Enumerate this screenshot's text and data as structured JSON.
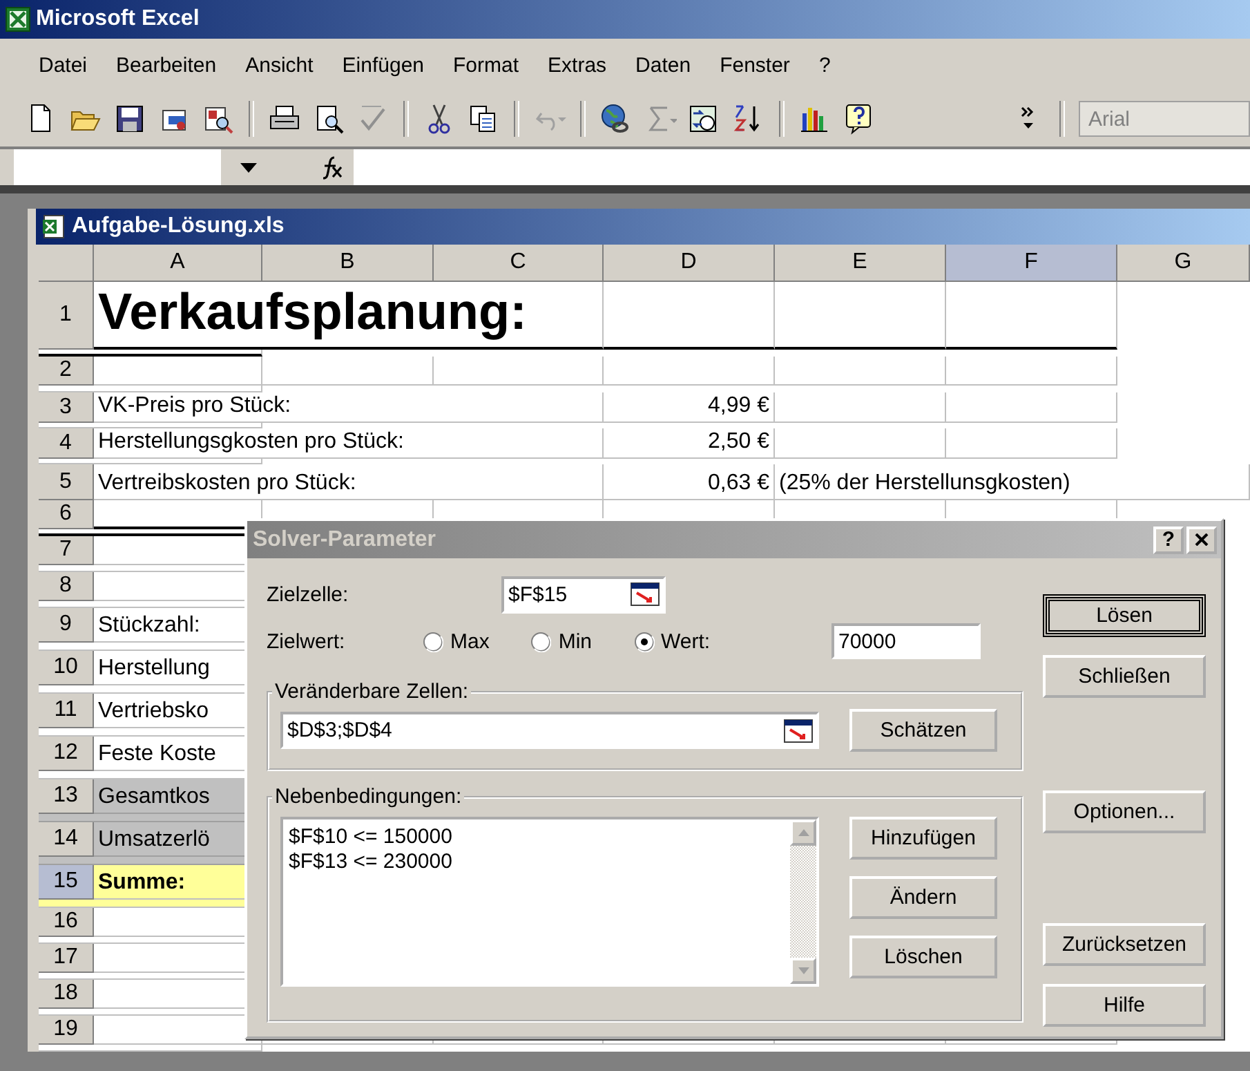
{
  "app": {
    "title": "Microsoft Excel"
  },
  "menu": [
    {
      "label": "Datei"
    },
    {
      "label": "Bearbeiten"
    },
    {
      "label": "Ansicht"
    },
    {
      "label": "Einfügen"
    },
    {
      "label": "Format"
    },
    {
      "label": "Extras"
    },
    {
      "label": "Daten"
    },
    {
      "label": "Fenster"
    },
    {
      "label": "?"
    }
  ],
  "toolbar": {
    "font_box": {
      "value": "Arial"
    }
  },
  "workbook": {
    "title": "Aufgabe-Lösung.xls",
    "columns": [
      {
        "label": "A",
        "selected": false
      },
      {
        "label": "B",
        "selected": false
      },
      {
        "label": "C",
        "selected": false
      },
      {
        "label": "D",
        "selected": false
      },
      {
        "label": "E",
        "selected": false
      },
      {
        "label": "F",
        "selected": true
      },
      {
        "label": "G",
        "selected": false
      }
    ],
    "rows": [
      {
        "number": "1",
        "selected": false,
        "kind": "heading",
        "a": "Verkaufsplanung:"
      },
      {
        "number": "2",
        "selected": false,
        "kind": "plain"
      },
      {
        "number": "3",
        "selected": false,
        "kind": "plain",
        "a": "VK-Preis pro Stück:",
        "d": "4,99 €"
      },
      {
        "number": "4",
        "selected": false,
        "kind": "plain",
        "a": "Herstellungsgkosten pro Stück:",
        "d": "2,50 €"
      },
      {
        "number": "5",
        "selected": false,
        "kind": "plain",
        "a": "Vertreibskosten pro Stück:",
        "d": "0,63 €",
        "e": "(25% der Herstellunsgkosten)"
      },
      {
        "number": "6",
        "selected": false,
        "kind": "divider"
      },
      {
        "number": "7",
        "selected": false,
        "kind": "plain"
      },
      {
        "number": "8",
        "selected": false,
        "kind": "plain"
      },
      {
        "number": "9",
        "selected": false,
        "kind": "tall",
        "a": "Stückzahl:"
      },
      {
        "number": "10",
        "selected": false,
        "kind": "tall",
        "a": "Herstellung"
      },
      {
        "number": "11",
        "selected": false,
        "kind": "tall",
        "a": "Vertriebsko"
      },
      {
        "number": "12",
        "selected": false,
        "kind": "tall",
        "a": "Feste Koste"
      },
      {
        "number": "13",
        "selected": false,
        "kind": "shaded",
        "a": "Gesamtkos"
      },
      {
        "number": "14",
        "selected": false,
        "kind": "shaded",
        "a": "Umsatzerlö"
      },
      {
        "number": "15",
        "selected": true,
        "kind": "total",
        "a": "Summe:"
      },
      {
        "number": "16",
        "selected": false,
        "kind": "plain"
      },
      {
        "number": "17",
        "selected": false,
        "kind": "plain"
      },
      {
        "number": "18",
        "selected": false,
        "kind": "plain"
      },
      {
        "number": "19",
        "selected": false,
        "kind": "plain"
      }
    ]
  },
  "solver": {
    "title": "Solver-Parameter",
    "help_button": "?",
    "target_label": "Zielzelle:",
    "target_value": "$F$15",
    "goal_label": "Zielwert:",
    "options": [
      {
        "label": "Max",
        "selected": false
      },
      {
        "label": "Min",
        "selected": false
      },
      {
        "label": "Wert:",
        "selected": true
      }
    ],
    "goal_value": "70000",
    "changing_label": "Veränderbare Zellen:",
    "changing_value": "$D$3;$D$4",
    "guess_button": "Schätzen",
    "constraints_label": "Nebenbedingungen:",
    "constraints": [
      "$F$10 <= 150000",
      "$F$13 <= 230000"
    ],
    "constraint_buttons": [
      "Hinzufügen",
      "Ändern",
      "Löschen"
    ],
    "side_buttons": [
      {
        "label": "Lösen",
        "default": true
      },
      {
        "label": "Schließen",
        "default": false
      },
      {
        "label": "Optionen...",
        "default": false
      },
      {
        "label": "Zurücksetzen",
        "default": false
      },
      {
        "label": "Hilfe",
        "default": false
      }
    ]
  }
}
